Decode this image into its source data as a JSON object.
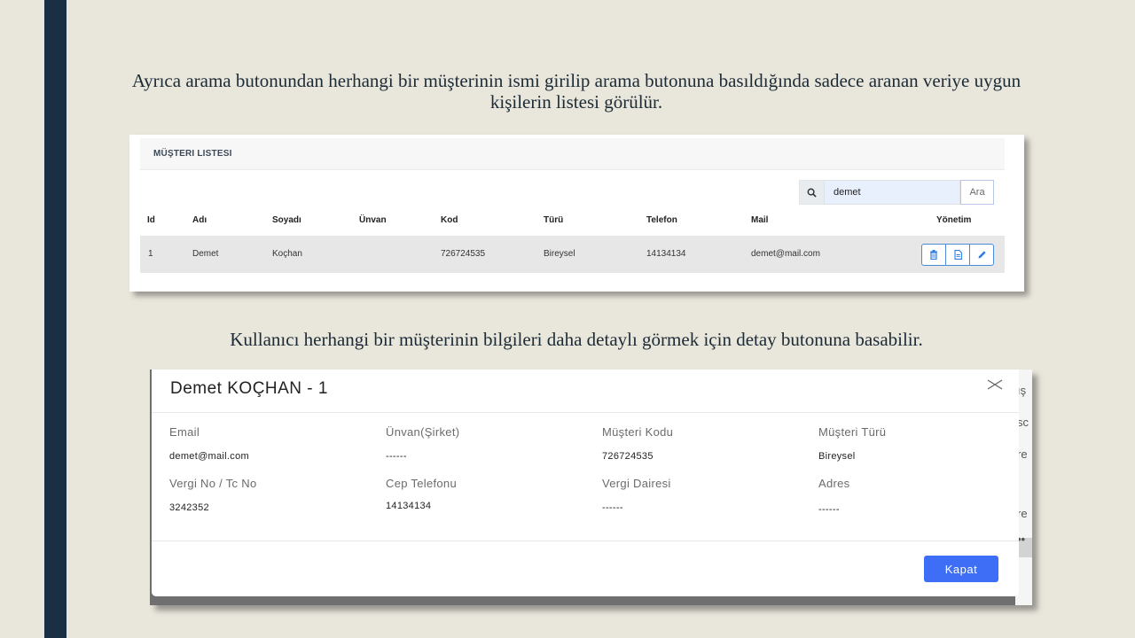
{
  "captions": {
    "top": "Ayrıca arama butonundan herhangi bir müşterinin ismi girilip arama butonuna basıldığında sadece aranan veriye uygun kişilerin listesi görülür.",
    "middle": "Kullanıcı herhangi bir müşterinin bilgileri daha detaylı görmek için detay butonuna basabilir."
  },
  "customer_list": {
    "title": "MÜŞTERI LISTESI",
    "search": {
      "value": "demet",
      "button_label": "Ara",
      "icon": "search-icon"
    },
    "columns": [
      "Id",
      "Adı",
      "Soyadı",
      "Ünvan",
      "Kod",
      "Türü",
      "Telefon",
      "Mail",
      "Yönetim"
    ],
    "rows": [
      {
        "id": "1",
        "ad": "Demet",
        "soyad": "Koçhan",
        "unvan": "",
        "kod": "726724535",
        "tur": "Bireysel",
        "telefon": "14134134",
        "mail": "demet@mail.com"
      }
    ],
    "action_icons": [
      "trash-icon",
      "document-icon",
      "pencil-icon"
    ],
    "accent_color": "#4a8cd8"
  },
  "detail_modal": {
    "title": "Demet KOÇHAN - 1",
    "fields_row1": [
      {
        "label": "Email",
        "value": "demet@mail.com"
      },
      {
        "label": "Ünvan(Şirket)",
        "value": "------"
      },
      {
        "label": "Müşteri Kodu",
        "value": "726724535"
      },
      {
        "label": "Müşteri Türü",
        "value": "Bireysel"
      }
    ],
    "fields_row2": [
      {
        "label": "Vergi No / Tc No",
        "value": "3242352"
      },
      {
        "label": "Cep Telefonu",
        "value": "14134134"
      },
      {
        "label": "Vergi Dairesi",
        "value": "------"
      },
      {
        "label": "Adres",
        "value": "------"
      }
    ],
    "close_button": "Kapat",
    "background_fragments": [
      "ış",
      "sc",
      "re",
      "re",
      "••"
    ],
    "button_color": "#3d6ef5"
  }
}
